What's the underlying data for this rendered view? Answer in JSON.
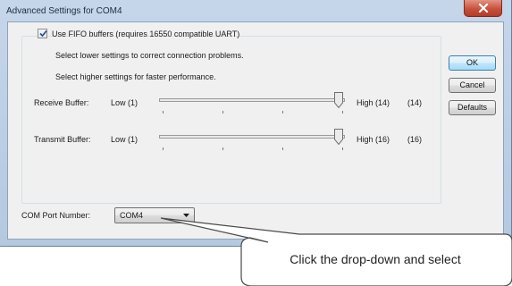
{
  "window": {
    "title": "Advanced Settings for COM4",
    "close_icon": "close-x-icon"
  },
  "fifo": {
    "checked": true,
    "label": "Use FIFO buffers (requires 16550 compatible UART)",
    "hint_lower": "Select lower settings to correct connection problems.",
    "hint_higher": "Select higher settings for faster performance."
  },
  "receive": {
    "label": "Receive Buffer:",
    "low_label": "Low (1)",
    "high_label": "High (14)",
    "value_display": "(14)",
    "level_fraction": 1.0
  },
  "transmit": {
    "label": "Transmit Buffer:",
    "low_label": "Low (1)",
    "high_label": "High (16)",
    "value_display": "(16)",
    "level_fraction": 1.0
  },
  "buttons": {
    "ok": "OK",
    "cancel": "Cancel",
    "defaults": "Defaults"
  },
  "com_port": {
    "label": "COM Port Number:",
    "selected": "COM4"
  },
  "callout": {
    "text": "Click the drop-down and select"
  }
}
